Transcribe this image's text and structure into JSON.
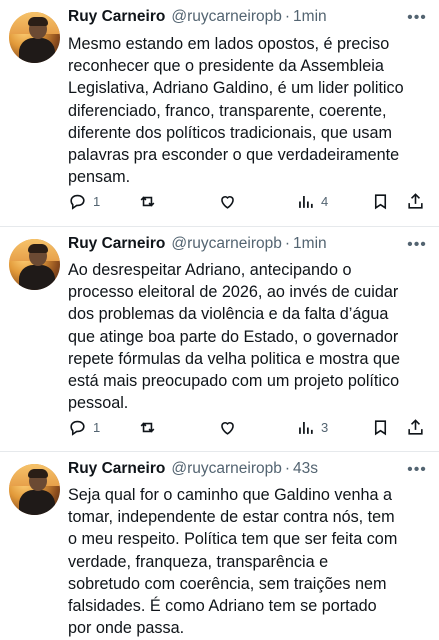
{
  "tweets": [
    {
      "name": "Ruy Carneiro",
      "handle": "@ruycarneiropb",
      "separator": "·",
      "time": "1min",
      "text": "Mesmo estando em lados opostos, é preciso\nreconhecer que o presidente da Assembleia\nLegislativa, Adriano Galdino, é um lider politico\ndiferenciado, franco, transparente, coerente,\ndiferente dos políticos tradicionais, que usam\npalavras pra esconder o que verdadeiramente\npensam.",
      "replies": "1",
      "retweets": "",
      "likes": "",
      "views": "4"
    },
    {
      "name": "Ruy Carneiro",
      "handle": "@ruycarneiropb",
      "separator": "·",
      "time": "1min",
      "text": "Ao desrespeitar Adriano, antecipando o\nprocesso eleitoral de 2026, ao invés de cuidar\ndos problemas da violência e da falta d’água\nque atinge boa parte do Estado, o governador\nrepete fórmulas da velha politica e mostra que\nestá mais preocupado com um projeto político\npessoal.",
      "replies": "1",
      "retweets": "",
      "likes": "",
      "views": "3"
    },
    {
      "name": "Ruy Carneiro",
      "handle": "@ruycarneiropb",
      "separator": "·",
      "time": "43s",
      "text": "Seja qual for o caminho que Galdino venha a\ntomar, independente de estar contra nós, tem\no meu respeito. Política tem que ser feita com\nverdade, franqueza, transparência e\nsobretudo com coerência, sem traições nem\nfalsidades. É como Adriano tem se portado\npor onde passa.",
      "replies": "",
      "retweets": "",
      "likes": "",
      "views": ""
    }
  ],
  "more_glyph": "•••",
  "icons": [
    "reply-icon",
    "retweet-icon",
    "like-icon",
    "views-icon",
    "bookmark-icon",
    "share-icon",
    "more-icon"
  ],
  "colors": {
    "text": "#0f1419",
    "muted": "#536471",
    "divider": "#e6e9ec"
  }
}
